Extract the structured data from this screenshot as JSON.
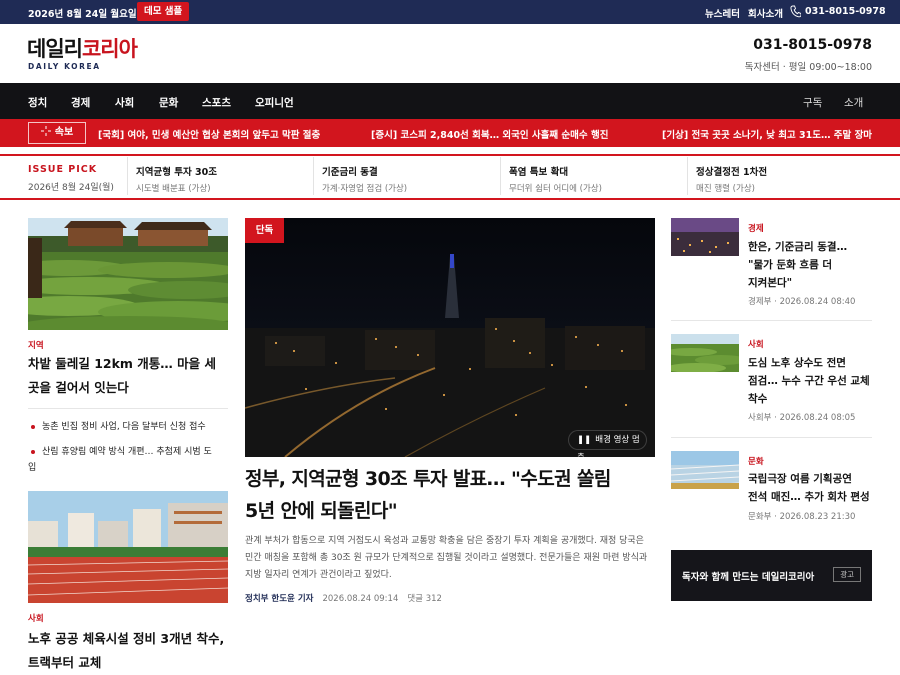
{
  "topbar": {
    "date": "2026년 8월 24일 월요일",
    "demo_badge": "데모 샘플",
    "links": [
      "뉴스레터",
      "회사소개"
    ],
    "phone": "031-8015-0978"
  },
  "header": {
    "logo_primary": "데일리",
    "logo_accent": "코리아",
    "logo_sub": "DAILY KOREA",
    "phone": "031-8015-0978",
    "hours": "독자센터 · 평일 09:00~18:00"
  },
  "nav": {
    "items": [
      "정치",
      "경제",
      "사회",
      "문화",
      "스포츠",
      "오피니언"
    ],
    "side": [
      "구독",
      "소개"
    ]
  },
  "ticker": {
    "label": "속보",
    "items": [
      "[국회] 여야, 민생 예산안 협상 본회의 앞두고 막판 절충",
      "[증시] 코스피 2,840선 회복… 외국인 사흘째 순매수 행진",
      "[기상] 전국 곳곳 소나기, 낮 최고 31도… 주말 장마"
    ]
  },
  "issue_pick": {
    "title": "ISSUE PICK",
    "date": "2026년 8월 24일(월)",
    "items": [
      {
        "title": "지역균형 투자 30조",
        "sub": "시도별 배분표 (가상)"
      },
      {
        "title": "기준금리 동결",
        "sub": "가계·자영업 점검 (가상)"
      },
      {
        "title": "폭염 특보 확대",
        "sub": "무더위 쉼터 어디에 (가상)"
      },
      {
        "title": "정상결정전 1차전",
        "sub": "매진 행렬 (가상)"
      }
    ]
  },
  "left": {
    "story1": {
      "category": "지역",
      "headline_l1": "차밭 둘레길 12km 개통… 마을 세",
      "headline_l2": "곳을 걸어서 잇는다"
    },
    "bullets": [
      {
        "l1": "농촌 빈집 정비 사업, 다음 달부터 신청 접수",
        "l2": ""
      },
      {
        "l1": "산림 휴양림 예약 방식 개편… 추첨제 시범 도",
        "l2": "입"
      }
    ],
    "story2": {
      "category": "사회",
      "headline_l1": "노후 공공 체육시설 정비 3개년 착수,",
      "headline_l2": "트랙부터 교체"
    }
  },
  "feature": {
    "badge": "단독",
    "video_control": "배경 영상 멈춤",
    "headline_l1": "정부, 지역균형 30조 투자 발표… \"수도권 쏠림",
    "headline_l2": "5년 안에 되돌린다\"",
    "body_l1": "관계 부처가 합동으로 지역 거점도시 육성과 교통망 확충을 담은 중장기 투자 계획을 공개했다. 재정 당국은",
    "body_l2": "민간 매칭을 포함해 총 30조 원 규모가 단계적으로 집행될 것이라고 설명했다. 전문가들은 재원 마련 방식과",
    "body_l3": "지방 일자리 연계가 관건이라고 짚었다.",
    "byline": "정치부 한도윤 기자",
    "timestamp": "2026.08.24 09:14",
    "comments": "댓글 312"
  },
  "right": {
    "items": [
      {
        "category": "경제",
        "l1": "한은, 기준금리 동결…",
        "l2": "\"물가 둔화 흐름 더",
        "l3": "지켜본다\"",
        "meta": "경제부 · 2026.08.24 08:40"
      },
      {
        "category": "사회",
        "l1": "도심 노후 상수도 전면",
        "l2": "점검… 누수 구간 우선 교체",
        "l3": "착수",
        "meta": "사회부 · 2026.08.24 08:05"
      },
      {
        "category": "문화",
        "l1": "국립극장 여름 기획공연",
        "l2": "전석 매진… 추가 회차 편성",
        "l3": "",
        "meta": "문화부 · 2026.08.23 21:30"
      }
    ],
    "promo": {
      "text": "독자와 함께 만드는 데일리코리아",
      "ad": "광고"
    }
  },
  "colors": {
    "navy": "#1f2b55",
    "red": "#d2151e",
    "nav_bg": "#121215"
  }
}
